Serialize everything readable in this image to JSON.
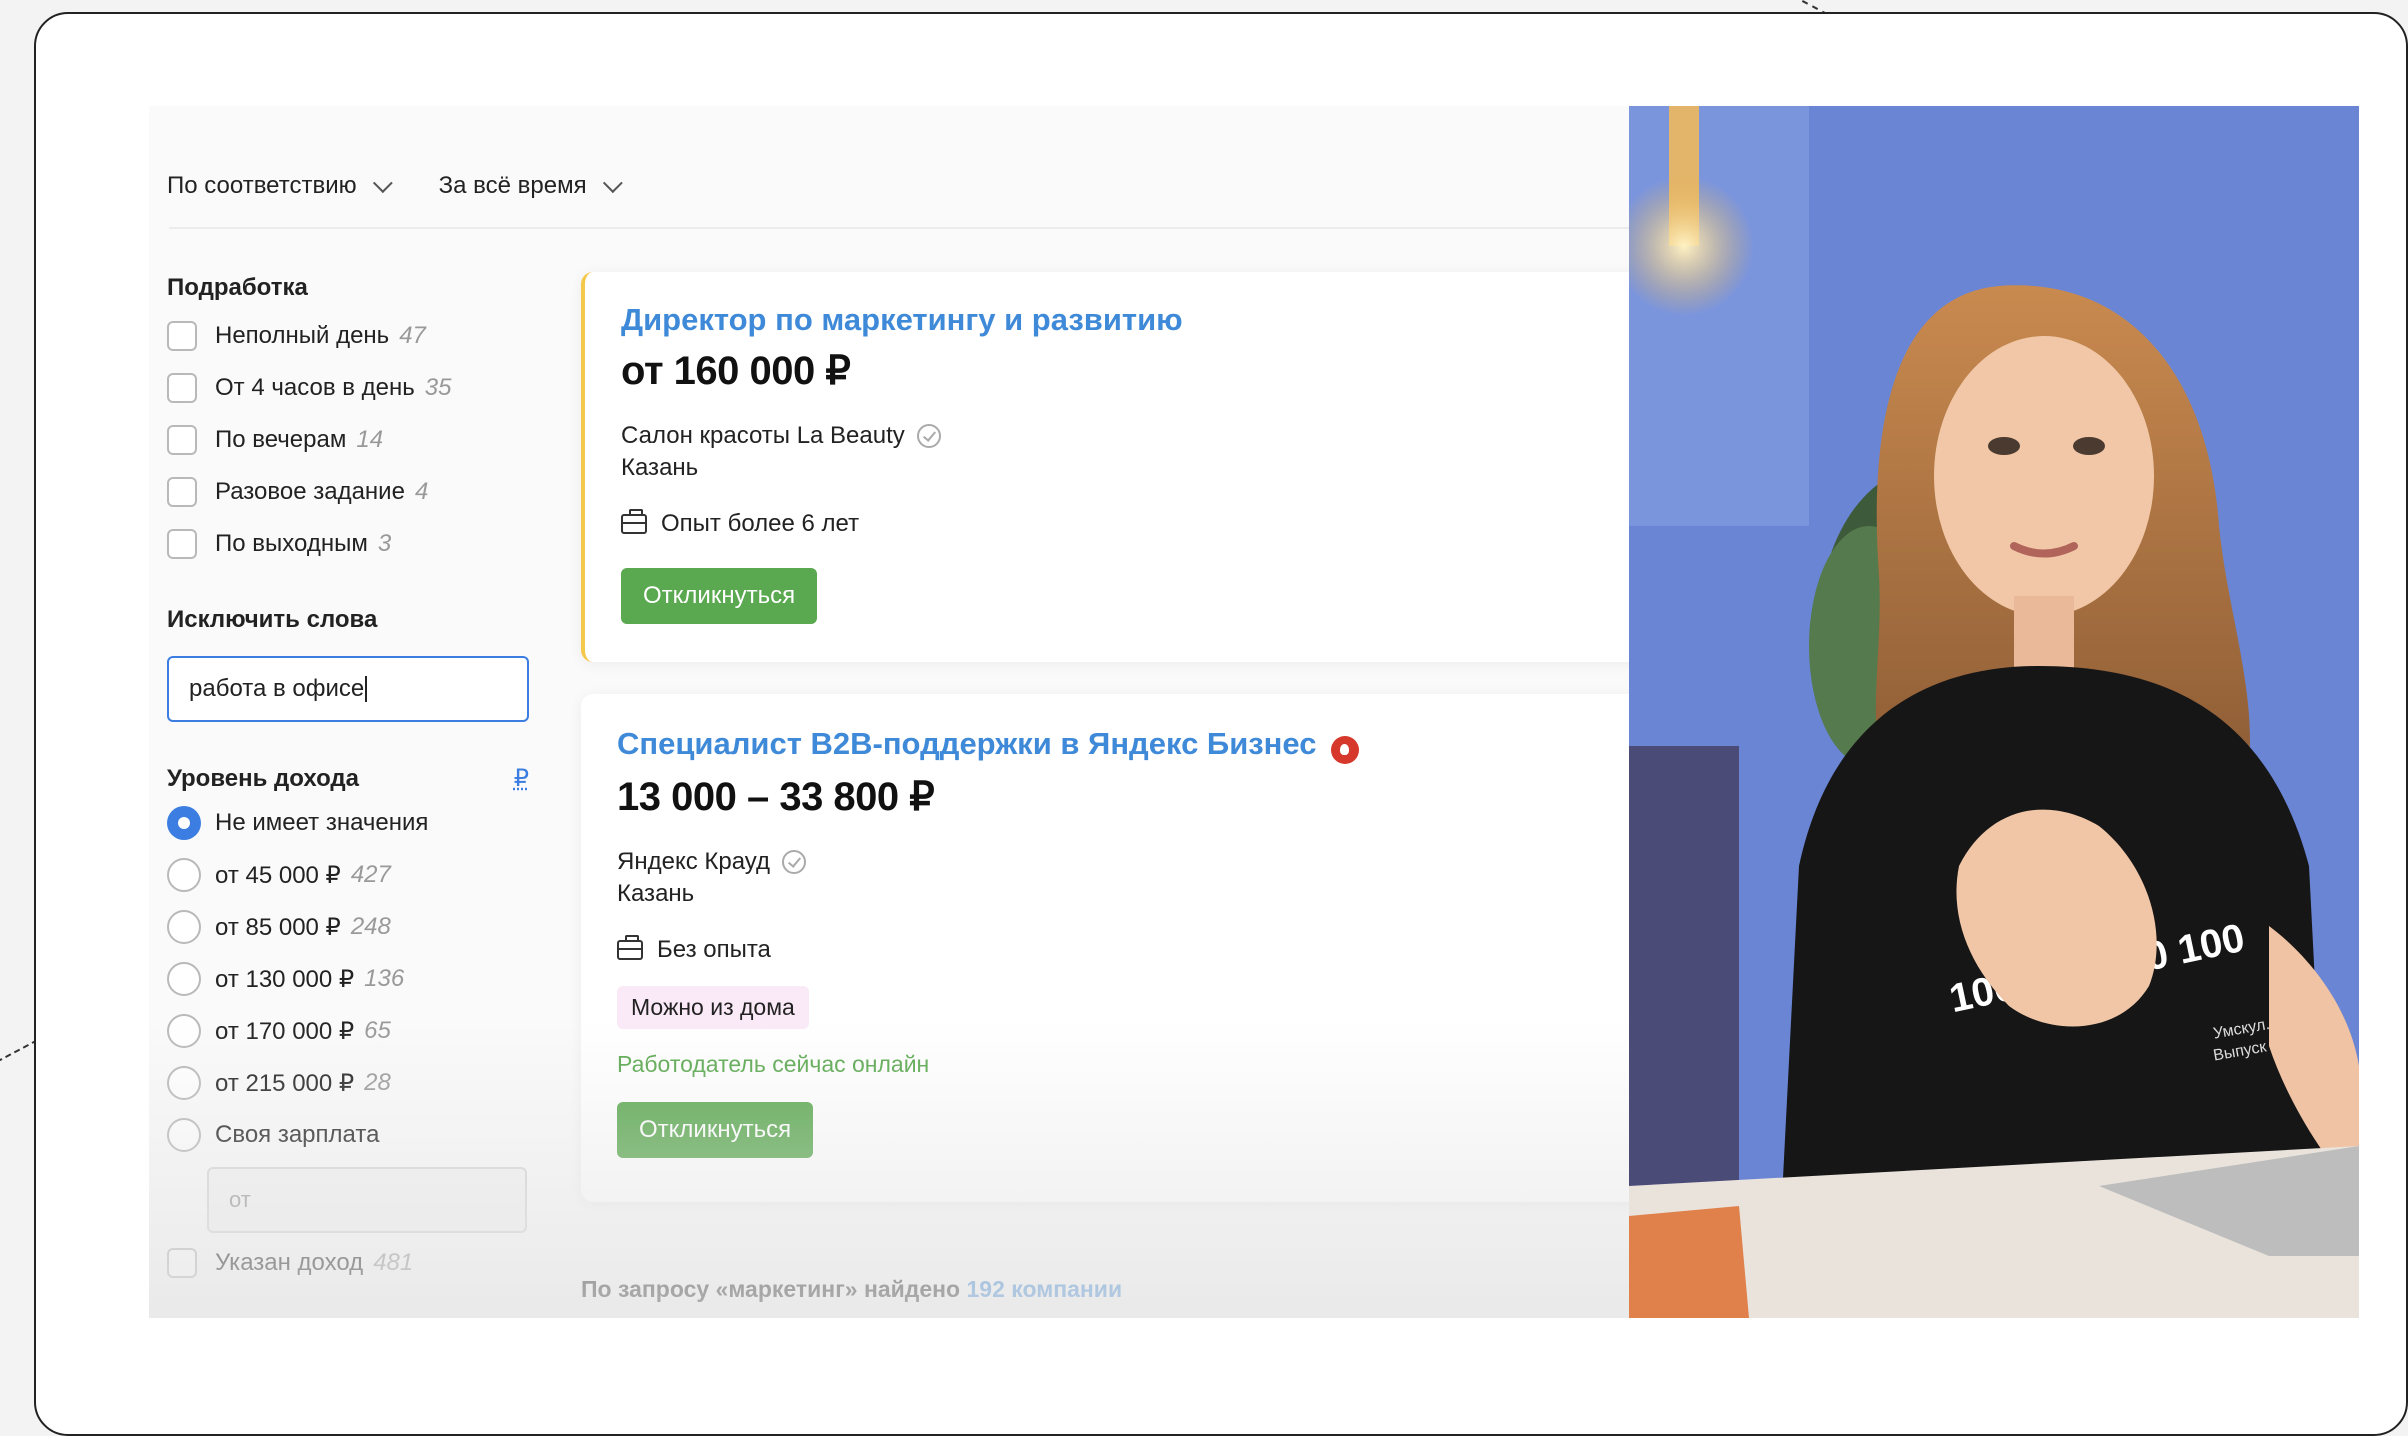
{
  "toolbar": {
    "sort_label": "По соответствию",
    "period_label": "За всё время"
  },
  "filters": {
    "parttime": {
      "title": "Подработка",
      "items": [
        {
          "label": "Неполный день",
          "count": "47"
        },
        {
          "label": "От 4 часов в день",
          "count": "35"
        },
        {
          "label": "По вечерам",
          "count": "14"
        },
        {
          "label": "Разовое задание",
          "count": "4"
        },
        {
          "label": "По выходным",
          "count": "3"
        }
      ]
    },
    "exclude": {
      "title": "Исключить слова",
      "value": "работа в офисе"
    },
    "income": {
      "title": "Уровень дохода",
      "currency": "₽",
      "options": [
        {
          "label": "Не имеет значения",
          "count": ""
        },
        {
          "label": "от 45 000 ₽",
          "count": "427"
        },
        {
          "label": "от 85 000 ₽",
          "count": "248"
        },
        {
          "label": "от 130 000 ₽",
          "count": "136"
        },
        {
          "label": "от 170 000 ₽",
          "count": "65"
        },
        {
          "label": "от 215 000 ₽",
          "count": "28"
        },
        {
          "label": "Своя зарплата",
          "count": ""
        }
      ],
      "custom_placeholder": "от",
      "specified": {
        "label": "Указан доход",
        "count": "481"
      }
    }
  },
  "vacancies": [
    {
      "title": "Директор по маркетингу и развитию",
      "salary": "от 160 000 ₽",
      "company": "Салон красоты La Beauty",
      "city": "Казань",
      "experience": "Опыт более 6 лет",
      "apply_label": "Откликнуться"
    },
    {
      "title": "Специалист B2B-поддержки в Яндекс Бизнес",
      "salary": "13 000 – 33 800 ₽",
      "company": "Яндекс Крауд",
      "city": "Казань",
      "experience": "Без опыта",
      "tag": "Можно из дома",
      "online_text": "Работодатель сейчас онлайн",
      "apply_label": "Откликнуться"
    }
  ],
  "footer": {
    "prefix": "По запросу «маркетинг»  найдено",
    "link": "192 компании"
  },
  "video": {
    "shirt_text": "100 100 100 100",
    "shirt_small_1": "Умскул.",
    "shirt_small_2": "Выпуск 2"
  },
  "colors": {
    "accent_blue": "#3f8ad8",
    "green": "#5aa84f",
    "highlight_yellow": "#f4c84a"
  }
}
